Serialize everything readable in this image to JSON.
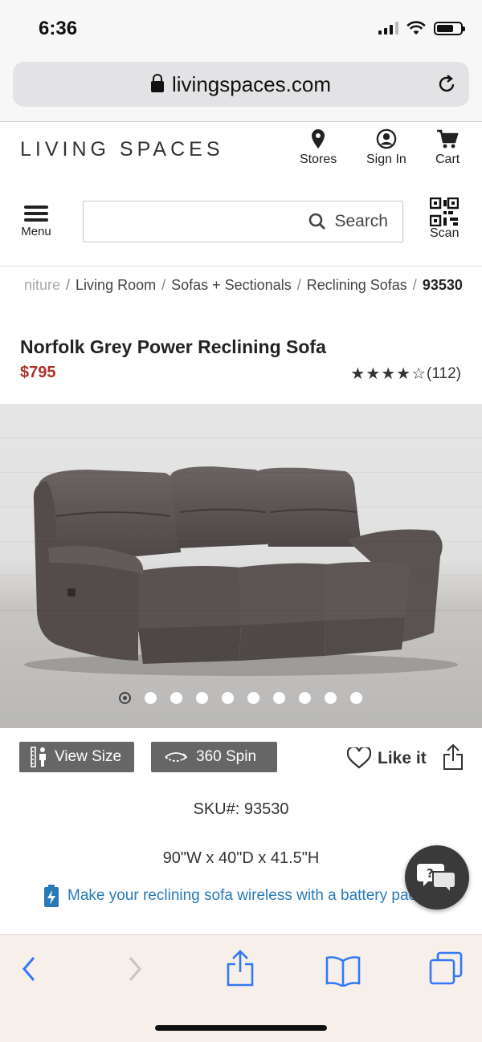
{
  "status_bar": {
    "time": "6:36"
  },
  "browser": {
    "url": "livingspaces.com"
  },
  "header": {
    "logo": "LIVING SPACES",
    "stores_label": "Stores",
    "signin_label": "Sign In",
    "cart_label": "Cart",
    "menu_label": "Menu",
    "search_placeholder": "Search",
    "scan_label": "Scan"
  },
  "breadcrumb": {
    "items": [
      "niture",
      "Living Room",
      "Sofas + Sectionals",
      "Reclining Sofas",
      "93530"
    ]
  },
  "product": {
    "title": "Norfolk Grey Power Reclining Sofa",
    "price": "$795",
    "rating_stars": "★★★★☆",
    "rating_value": 4.5,
    "review_count": "(112)",
    "image_count": 10,
    "active_image": 1
  },
  "actions": {
    "view_size": "View Size",
    "spin": "360 Spin",
    "like": "Like it"
  },
  "details": {
    "sku": "SKU#: 93530",
    "dimensions": "90\"W x 40\"D x 41.5\"H",
    "battery_promo": "Make your reclining sofa wireless with a battery pack ›"
  },
  "colors": {
    "price": "#b0312a",
    "link": "#2a7ab8",
    "chip_bg": "#666666",
    "safari_blue": "#3478f6"
  }
}
